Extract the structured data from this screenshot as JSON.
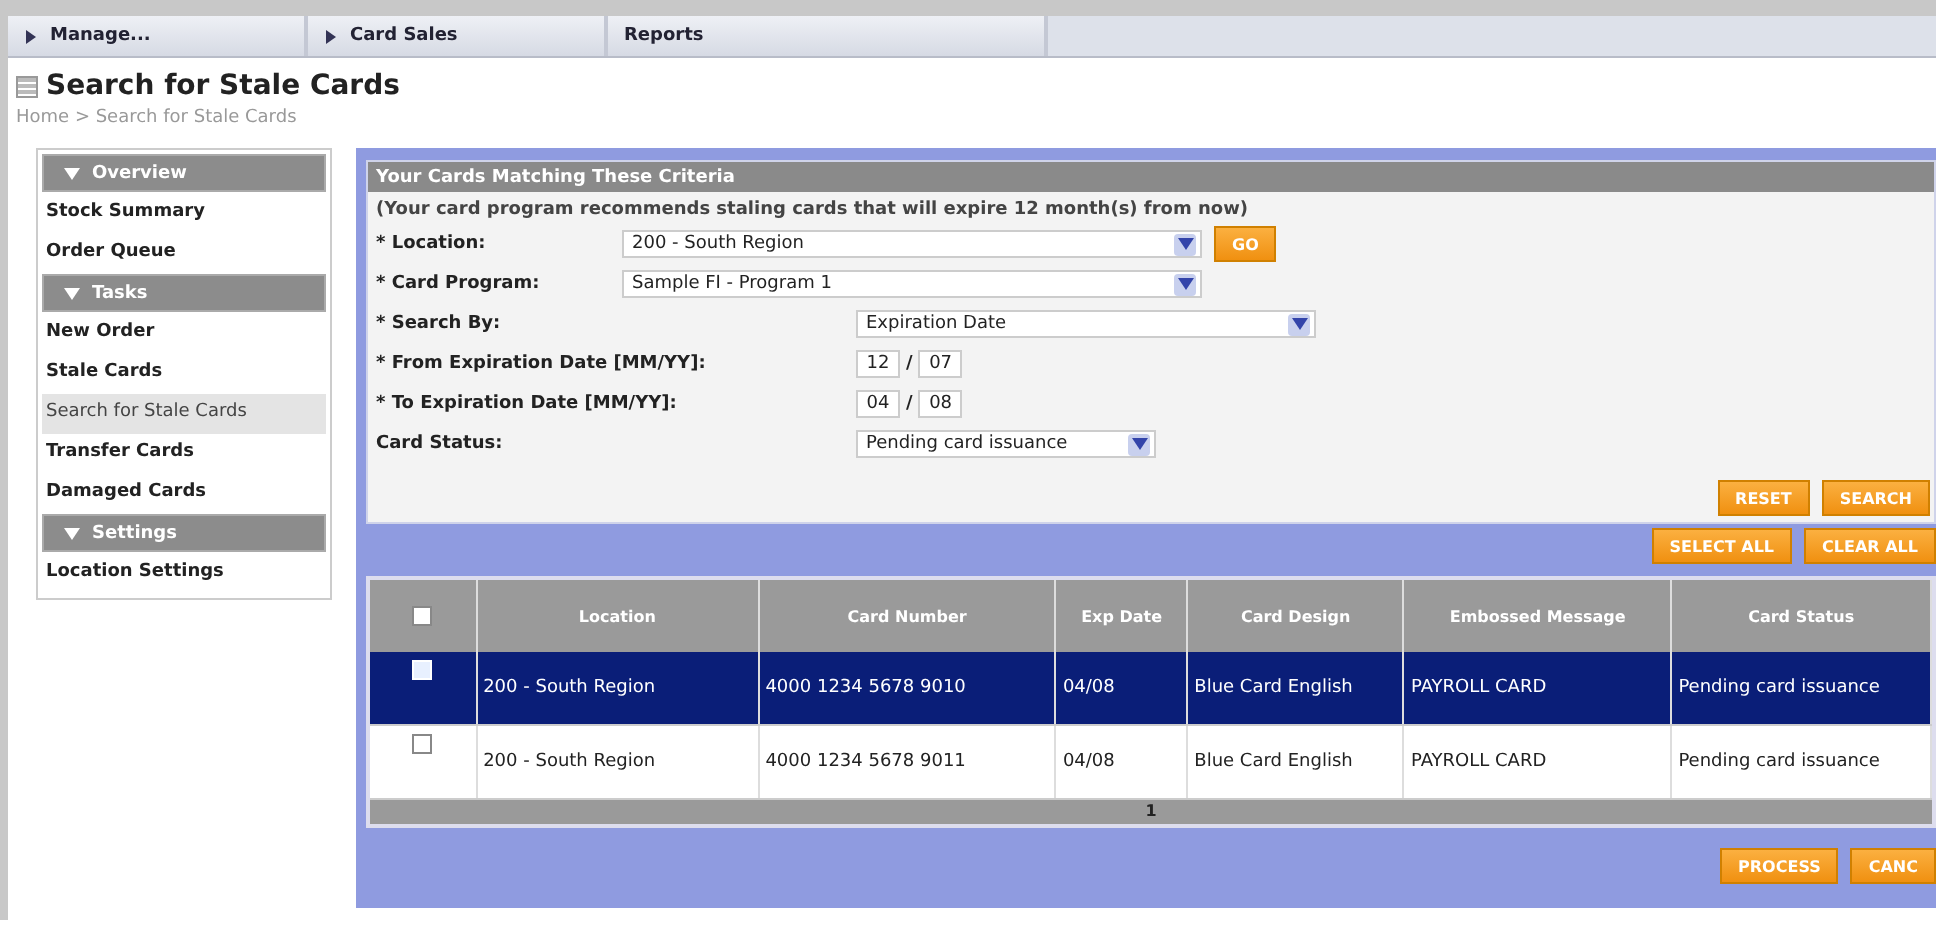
{
  "nav_tabs": [
    {
      "label": "Manage...",
      "arrow": true
    },
    {
      "label": "Card Sales",
      "arrow": true
    },
    {
      "label": "Reports",
      "arrow": false
    }
  ],
  "page_title": "Search for Stale Cards",
  "breadcrumb": "Home > Search for Stale Cards",
  "sidebar": [
    {
      "title": "Overview",
      "items": [
        {
          "label": "Stock Summary",
          "selected": false
        },
        {
          "label": "Order Queue",
          "selected": false
        }
      ]
    },
    {
      "title": "Tasks",
      "items": [
        {
          "label": "New Order",
          "selected": false
        },
        {
          "label": "Stale Cards",
          "selected": false
        },
        {
          "label": "Search for Stale Cards",
          "selected": true
        },
        {
          "label": "Transfer Cards",
          "selected": false
        },
        {
          "label": "Damaged Cards",
          "selected": false
        }
      ]
    },
    {
      "title": "Settings",
      "items": [
        {
          "label": "Location Settings",
          "selected": false
        }
      ]
    }
  ],
  "criteria": {
    "title": "Your Cards Matching These Criteria",
    "note": "(Your card program recommends staling cards that will expire 12 month(s) from now)",
    "fields": [
      {
        "kind": "select",
        "label": "* Location:",
        "value": "200 - South Region",
        "button": "GO"
      },
      {
        "kind": "select",
        "label": "* Card Program:",
        "value": "Sample FI - Program 1"
      },
      {
        "kind": "select",
        "label": "* Search By:",
        "value": "Expiration Date"
      },
      {
        "kind": "date",
        "label": "* From Expiration Date [MM/YY]:",
        "month": "12",
        "separator": "/",
        "year": "07"
      },
      {
        "kind": "date",
        "label": "* To Expiration Date [MM/YY]:",
        "month": "04",
        "separator": "/",
        "year": "08"
      },
      {
        "kind": "select",
        "label": "Card Status:",
        "value": "Pending card issuance"
      }
    ],
    "buttons": [
      "RESET",
      "SEARCH"
    ]
  },
  "table_buttons": [
    "SELECT ALL",
    "CLEAR ALL"
  ],
  "table": {
    "header_checked": false,
    "columns": [
      "Location",
      "Card Number",
      "Exp Date",
      "Card Design",
      "Embossed Message",
      "Card Status"
    ],
    "rows": [
      {
        "selected": true,
        "checked": false,
        "cells": [
          "200 - South Region",
          "4000 1234 5678 9010",
          "04/08",
          "Blue Card English",
          "PAYROLL CARD",
          "Pending card issuance"
        ]
      },
      {
        "selected": false,
        "checked": false,
        "cells": [
          "200 - South Region",
          "4000 1234 5678 9011",
          "04/08",
          "Blue Card English",
          "PAYROLL CARD",
          "Pending card issuance"
        ]
      }
    ],
    "page": "1"
  },
  "bottom_buttons": [
    "PROCESS",
    "CANC"
  ]
}
